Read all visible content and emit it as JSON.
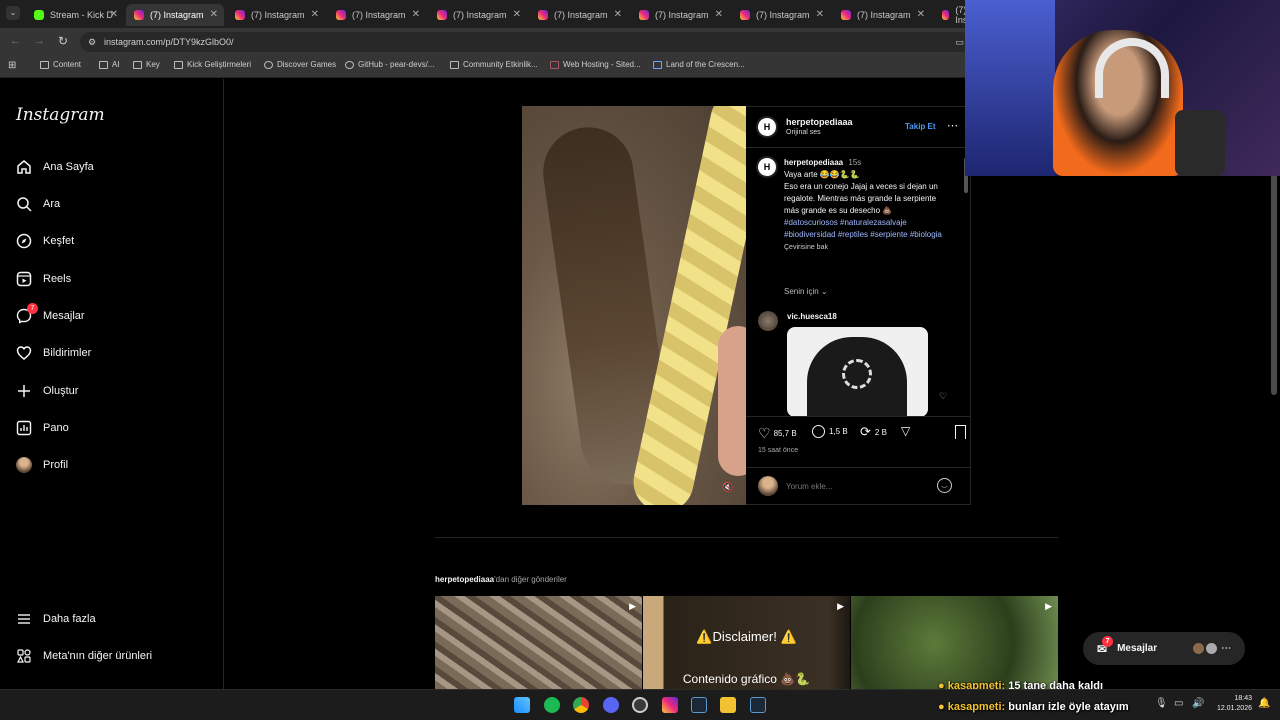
{
  "browser": {
    "tabs": [
      {
        "label": "Stream - Kick D"
      },
      {
        "label": "(7) Instagram"
      },
      {
        "label": "(7) Instagram"
      },
      {
        "label": "(7) Instagram"
      },
      {
        "label": "(7) Instagram"
      },
      {
        "label": "(7) Instagram"
      },
      {
        "label": "(7) Instagram"
      },
      {
        "label": "(7) Instagram"
      },
      {
        "label": "(7) Instagram"
      },
      {
        "label": "(7) Ins"
      }
    ],
    "url": "instagram.com/p/DTY9kzGlbO0/",
    "bookmarks": [
      "Content",
      "AI",
      "Key",
      "Kick Geliştirmeleri",
      "Discover Games",
      "GitHub - pear-devs/...",
      "Community Etkinlik...",
      "Web Hosting - Sited...",
      "Land of the Crescen..."
    ]
  },
  "sidebar": {
    "logo": "Instagram",
    "items": [
      {
        "label": "Ana Sayfa",
        "icon": "home-icon"
      },
      {
        "label": "Ara",
        "icon": "search-icon"
      },
      {
        "label": "Keşfet",
        "icon": "compass-icon"
      },
      {
        "label": "Reels",
        "icon": "reels-icon"
      },
      {
        "label": "Mesajlar",
        "icon": "messenger-icon",
        "badge": "7"
      },
      {
        "label": "Bildirimler",
        "icon": "heart-icon"
      },
      {
        "label": "Oluştur",
        "icon": "plus-icon"
      },
      {
        "label": "Pano",
        "icon": "chart-icon"
      },
      {
        "label": "Profil",
        "icon": "avatar"
      }
    ],
    "more": "Daha fazla",
    "meta": "Meta'nın diğer ürünleri"
  },
  "post": {
    "username": "herpetopediaaa",
    "audio": "Orijinal ses",
    "follow": "Takip Et",
    "caption_user": "herpetopediaaa",
    "caption_time": "15s",
    "caption_line1": "Vaya arte 😂😂🐍🐍",
    "caption_body": "Eso era un conejo Jajaj a veces si dejan un regalote. Mientras más grande la serpiente más grande es su desecho",
    "caption_tags": "#datoscuriosos #naturalezasalvaje #biodiversidad #reptiles #serpiente #biologia",
    "translate": "Çevirisine bak",
    "for_you": "Senin için",
    "commenter": "vic.huesca18",
    "likes": "85,7 B",
    "comments": "1,5 B",
    "reposts": "2 B",
    "time_ago": "15 saat önce",
    "comment_placeholder": "Yorum ekle..."
  },
  "more_posts": {
    "heading_user": "herpetopediaaa",
    "heading_rest": "'dan diğer gönderiler",
    "thumb2_line1": "⚠️Disclaimer! ⚠️",
    "thumb2_line2": "Contenido gráfico 💩🐍"
  },
  "messages_pill": {
    "label": "Mesajlar",
    "badge": "7"
  },
  "stream_chat": [
    {
      "user": "kasapmeti:",
      "text": "15 tane daha kaldı"
    },
    {
      "user": "kasapmeti:",
      "text": "bunları izle öyle atayım"
    }
  ],
  "clock": {
    "time": "18:43",
    "date": "12.01.2026"
  }
}
